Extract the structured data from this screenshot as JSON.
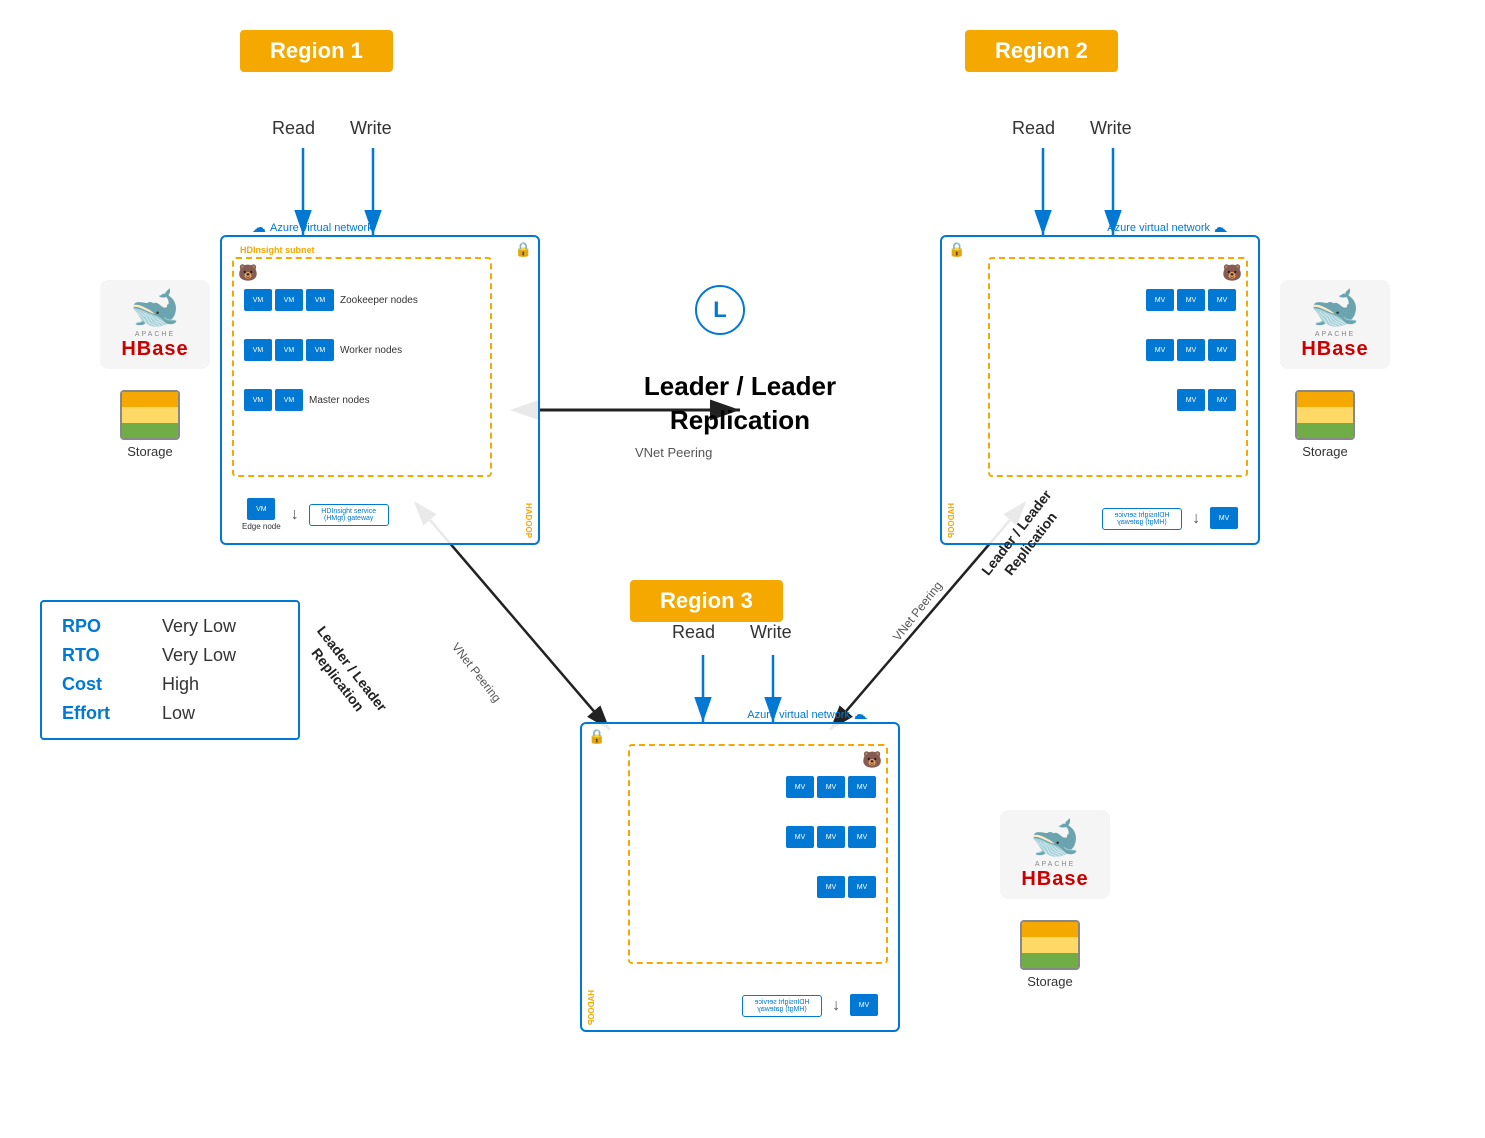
{
  "regions": [
    {
      "id": "region1",
      "label": "Region 1"
    },
    {
      "id": "region2",
      "label": "Region 2"
    },
    {
      "id": "region3",
      "label": "Region 3"
    }
  ],
  "center": {
    "leader_replication": "Leader / Leader\nReplication",
    "vnet_peering": "VNet Peering"
  },
  "arrows": {
    "read": "Read",
    "write": "Write"
  },
  "leader_left": "Leader / Leader\nReplication",
  "leader_right": "Leader / Leader\nReplication",
  "vnet_left": "VNet Peering",
  "vnet_right": "VNet Peering",
  "info": {
    "rpo_key": "RPO",
    "rpo_val": "Very Low",
    "rto_key": "RTO",
    "rto_val": "Very Low",
    "cost_key": "Cost",
    "cost_val": "High",
    "effort_key": "Effort",
    "effort_val": "Low"
  },
  "storage_label": "Storage",
  "nodes": {
    "zookeeper": "Zookeeper\nnodes",
    "worker": "Worker\nnodes",
    "master": "Master\nnodes",
    "edge": "Edge\nnode",
    "gateway": "HDInsight\nservice (HMgt)\ngateway"
  },
  "azure_vnet": "Azure virtual network",
  "hdinsight_subnet": "HDInsight subnet"
}
